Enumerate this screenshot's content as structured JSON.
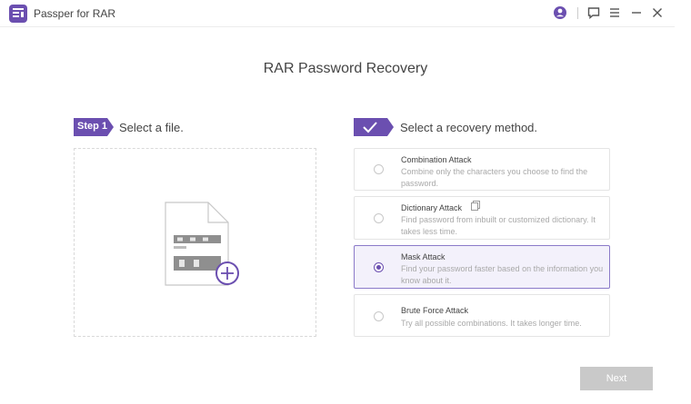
{
  "titlebar": {
    "app_name": "Passper for RAR",
    "icons": [
      "account-icon",
      "feedback-icon",
      "menu-icon",
      "minimize-icon",
      "close-icon"
    ]
  },
  "main": {
    "title": "RAR Password Recovery"
  },
  "step1": {
    "badge": "Step 1",
    "label": "Select a file.",
    "dropzone_icon": "add-file-icon"
  },
  "step2": {
    "label": "Select a recovery method.",
    "methods": [
      {
        "name": "Combination Attack",
        "desc": "Combine only the characters you choose to find the password.",
        "selected": false
      },
      {
        "name": "Dictionary Attack",
        "desc": "Find password from inbuilt or customized dictionary. It takes less time.",
        "selected": false
      },
      {
        "name": "Mask Attack",
        "desc": "Find your password faster based on the information you know about it.",
        "selected": true
      },
      {
        "name": "Brute Force Attack",
        "desc": "Try all possible combinations. It takes longer time.",
        "selected": false
      }
    ]
  },
  "footer": {
    "next_label": "Next"
  },
  "colors": {
    "accent": "#6b4fb0",
    "selected_bg": "#f3f1fb",
    "button_disabled": "#c9c9c9"
  }
}
